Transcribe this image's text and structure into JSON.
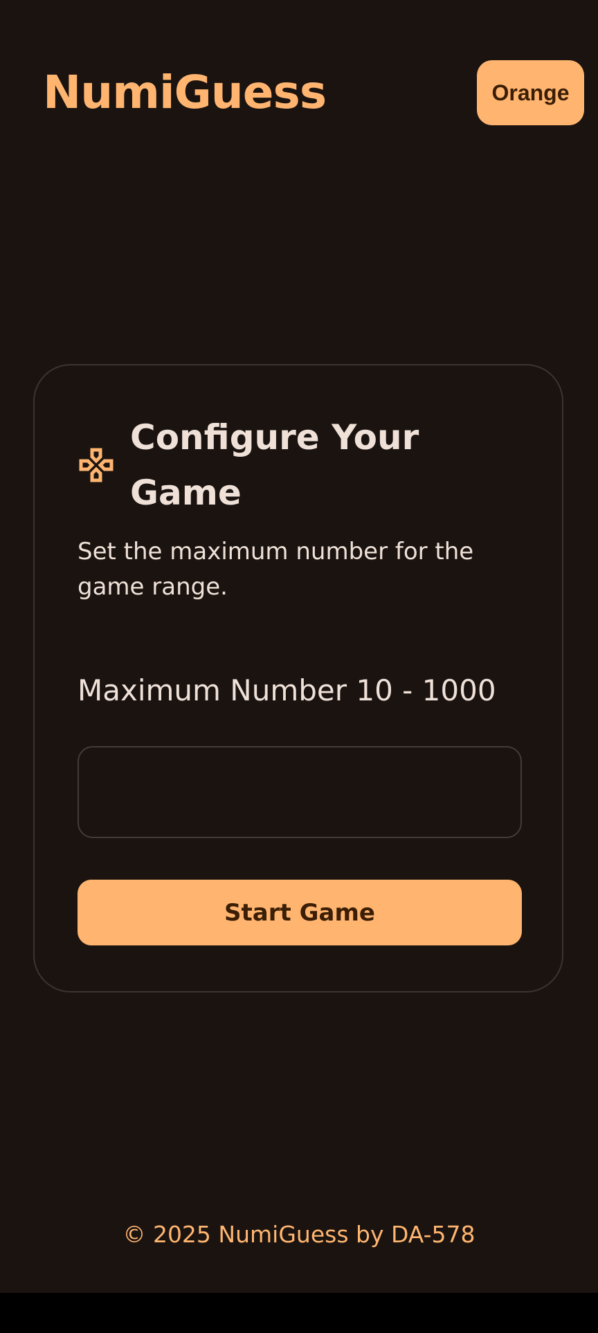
{
  "header": {
    "app_title": "NumiGuess",
    "theme_button_label": "Orange"
  },
  "config_card": {
    "icon": "gamepad-icon",
    "title": "Configure Your Game",
    "description": "Set the maximum number for the game range.",
    "field_label": "Maximum Number 10 - 1000",
    "max_number_value": "",
    "max_number_placeholder": "",
    "start_button_label": "Start Game"
  },
  "footer": {
    "text": "© 2025 NumiGuess by DA-578"
  },
  "colors": {
    "background": "#1a1310",
    "accent": "#ffb570",
    "accent_text": "#3b1e05",
    "text": "#efe1d8",
    "border": "#3c3431"
  }
}
